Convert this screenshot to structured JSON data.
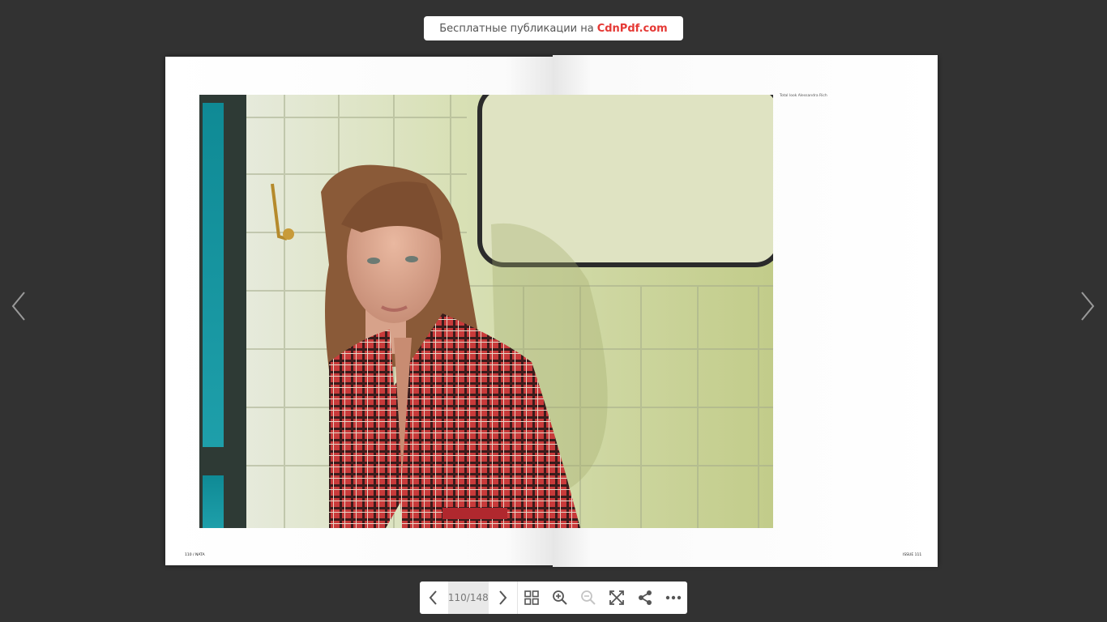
{
  "banner": {
    "text": "Бесплатные публикации на",
    "brand": "CdnPdf.com"
  },
  "viewer": {
    "current_page": "110",
    "total_pages": "148",
    "page_counter": "110/148"
  },
  "spread": {
    "caption": "Total look Alessandra Rich",
    "folio_left": "110 / NATA",
    "folio_right": "ISSUE 111"
  },
  "icons": {
    "prev": "chevron-left-icon",
    "next": "chevron-right-icon",
    "thumbnails": "grid-icon",
    "zoom_in": "zoom-in-icon",
    "zoom_out": "zoom-out-icon",
    "fullscreen": "fullscreen-icon",
    "share": "share-icon",
    "more": "more-icon"
  },
  "colors": {
    "background": "#323232",
    "brand": "#e53935",
    "toolbar_bg": "#ffffff"
  }
}
